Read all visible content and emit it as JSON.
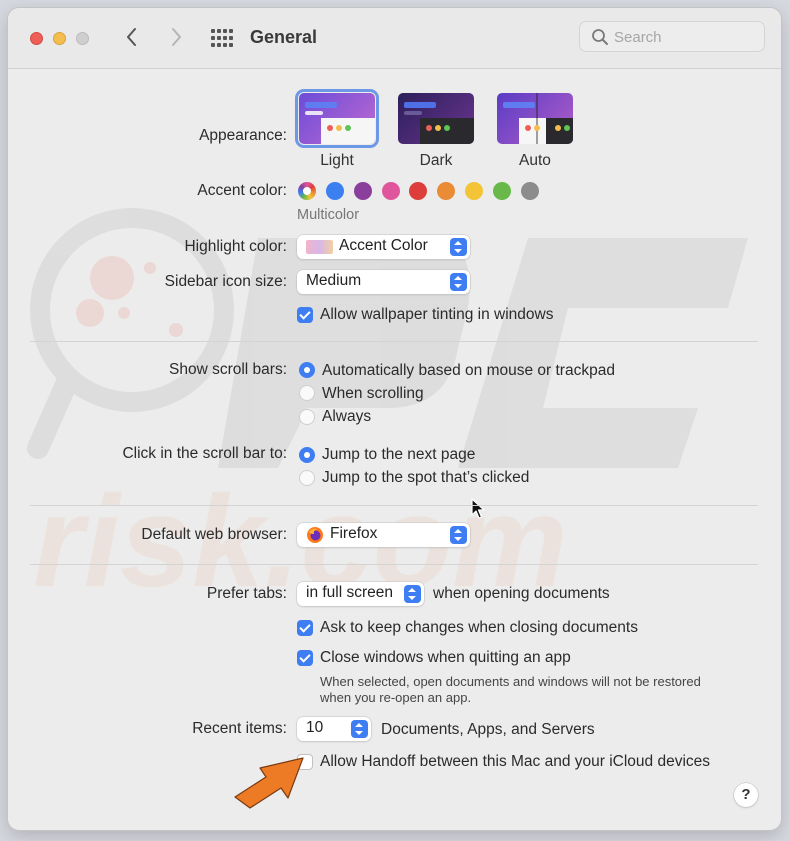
{
  "window": {
    "title": "General",
    "search_placeholder": "Search"
  },
  "appearance": {
    "label": "Appearance:",
    "options": [
      "Light",
      "Dark",
      "Auto"
    ],
    "selected": "Light"
  },
  "accent": {
    "label": "Accent color:",
    "selected_name": "Multicolor",
    "colors": [
      "multicolor",
      "#3b7ff1",
      "#8a3f9c",
      "#e0569c",
      "#de3e3b",
      "#ea8b35",
      "#f3c536",
      "#68b94a",
      "#8c8c8c"
    ]
  },
  "highlight": {
    "label": "Highlight color:",
    "value": "Accent Color"
  },
  "sidebar_icon": {
    "label": "Sidebar icon size:",
    "value": "Medium"
  },
  "wallpaper_tinting": {
    "label": "Allow wallpaper tinting in windows",
    "checked": true
  },
  "scroll_bars": {
    "label": "Show scroll bars:",
    "options": [
      "Automatically based on mouse or trackpad",
      "When scrolling",
      "Always"
    ],
    "selected": "Automatically based on mouse or trackpad"
  },
  "scroll_click": {
    "label": "Click in the scroll bar to:",
    "options": [
      "Jump to the next page",
      "Jump to the spot that’s clicked"
    ],
    "selected": "Jump to the next page"
  },
  "browser": {
    "label": "Default web browser:",
    "value": "Firefox"
  },
  "tabs": {
    "label": "Prefer tabs:",
    "value": "in full screen",
    "suffix": "when opening documents"
  },
  "ask_keep_changes": {
    "label": "Ask to keep changes when closing documents",
    "checked": true
  },
  "close_windows": {
    "label": "Close windows when quitting an app",
    "checked": true,
    "description": "When selected, open documents and windows will not be restored when you re-open an app."
  },
  "recent_items": {
    "label": "Recent items:",
    "value": "10",
    "suffix": "Documents, Apps, and Servers"
  },
  "handoff": {
    "label": "Allow Handoff between this Mac and your iCloud devices",
    "checked": false
  },
  "help_button": {
    "label": "?"
  },
  "colors": {
    "accent_blue": "#3e7ef2",
    "arrow_orange": "#ed7a25",
    "window_bg": "#ececec"
  }
}
